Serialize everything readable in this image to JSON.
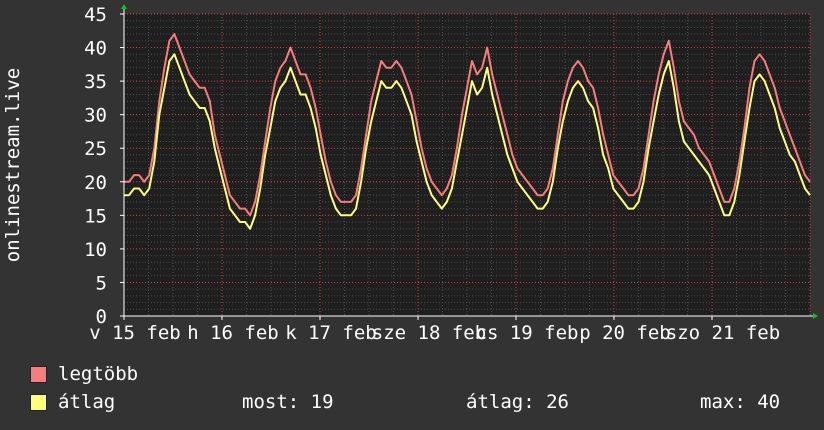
{
  "chart_data": {
    "type": "line",
    "ylabel": "onlinestream.live",
    "ylim": [
      0,
      45
    ],
    "yticks": [
      "0",
      "5",
      "10",
      "15",
      "20",
      "25",
      "30",
      "35",
      "40",
      "45"
    ],
    "xticks": [
      "v 15 feb",
      "h 16 feb",
      "k 17 feb",
      "sze 18 feb",
      "cs 19 feb",
      "p 20 feb",
      "szo 21 feb"
    ],
    "xlabel": "",
    "grid": true,
    "series": [
      {
        "name": "legtöbb",
        "color": "#f87c7c",
        "values": [
          20,
          20,
          21,
          21,
          20,
          21,
          25,
          32,
          37,
          41,
          42,
          40,
          38,
          36,
          35,
          34,
          34,
          32,
          27,
          24,
          21,
          18,
          17,
          16,
          16,
          15,
          17,
          21,
          26,
          31,
          35,
          37,
          38,
          40,
          38,
          36,
          36,
          34,
          31,
          27,
          23,
          20,
          18,
          17,
          17,
          17,
          18,
          22,
          27,
          32,
          35,
          38,
          37,
          37,
          38,
          37,
          35,
          33,
          29,
          25,
          22,
          20,
          19,
          18,
          19,
          21,
          25,
          30,
          34,
          38,
          36,
          37,
          40,
          36,
          33,
          30,
          27,
          24,
          22,
          21,
          20,
          19,
          18,
          18,
          19,
          22,
          27,
          32,
          35,
          37,
          38,
          37,
          35,
          34,
          31,
          27,
          24,
          21,
          20,
          19,
          18,
          18,
          19,
          22,
          27,
          32,
          36,
          39,
          41,
          37,
          32,
          29,
          28,
          27,
          25,
          24,
          23,
          21,
          19,
          17,
          17,
          19,
          23,
          28,
          34,
          38,
          39,
          38,
          36,
          34,
          31,
          29,
          27,
          25,
          23,
          21,
          20
        ]
      },
      {
        "name": "átlag",
        "color": "#ffff7c",
        "values": [
          18,
          18,
          19,
          19,
          18,
          19,
          23,
          30,
          34,
          38,
          39,
          37,
          35,
          33,
          32,
          31,
          31,
          29,
          25,
          22,
          19,
          16,
          15,
          14,
          14,
          13,
          15,
          19,
          24,
          28,
          32,
          34,
          35,
          37,
          35,
          33,
          33,
          31,
          28,
          24,
          21,
          18,
          16,
          15,
          15,
          15,
          16,
          20,
          25,
          29,
          32,
          35,
          34,
          34,
          35,
          34,
          32,
          30,
          26,
          23,
          20,
          18,
          17,
          16,
          17,
          19,
          23,
          27,
          31,
          35,
          33,
          34,
          37,
          33,
          30,
          27,
          24,
          22,
          20,
          19,
          18,
          17,
          16,
          16,
          17,
          20,
          25,
          29,
          32,
          34,
          35,
          34,
          32,
          31,
          28,
          24,
          22,
          19,
          18,
          17,
          16,
          16,
          17,
          20,
          25,
          29,
          33,
          36,
          38,
          34,
          29,
          26,
          25,
          24,
          23,
          22,
          21,
          19,
          17,
          15,
          15,
          17,
          21,
          26,
          31,
          35,
          36,
          35,
          33,
          31,
          28,
          26,
          24,
          23,
          21,
          19,
          18
        ]
      }
    ]
  },
  "legend": {
    "max_label": "legtöbb",
    "avg_label": "átlag"
  },
  "stats": {
    "current": "most: 19",
    "average": "átlag: 26",
    "maximum": "max: 40"
  },
  "colors": {
    "background": "#333333",
    "plot_background": "#1f1f1f",
    "axis": "#ffffff",
    "grid_major": "#cc3b3b",
    "grid_minor": "#4a4a4a",
    "arrow": "#00cc00"
  }
}
